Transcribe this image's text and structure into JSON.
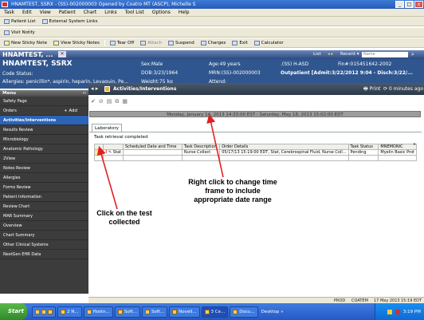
{
  "window": {
    "title": "HNAMTEST, SSRX - (SS)-002000003 Opened by Coatro MT (ASCP), Michelle S"
  },
  "menu": [
    "Task",
    "Edit",
    "View",
    "Patient",
    "Chart",
    "Links",
    "Tool List",
    "Options",
    "Help"
  ],
  "toolbar1": [
    {
      "label": "Patient List"
    },
    {
      "label": "External System Links"
    }
  ],
  "toolbar2": [
    {
      "label": "Visit Notify"
    }
  ],
  "toolbar3": [
    {
      "label": "New Sticky Note"
    },
    {
      "label": "View Sticky Notes"
    },
    {
      "label": "Tear Off"
    },
    {
      "label": "Attach"
    },
    {
      "label": "Suspend"
    },
    {
      "label": "Charges"
    },
    {
      "label": "Exit"
    },
    {
      "label": "Calculator"
    }
  ],
  "nav": {
    "short_name": "HNAMTEST, ...",
    "list": "List",
    "recent": "Recent",
    "name_placeholder": "Name"
  },
  "banner": {
    "name": "HNAMTEST, SSRX",
    "code_status": "Code Status:",
    "allergies": "Allergies: penicillin*, aspirin, heparin, Levaquin, Pe...",
    "sex": "Sex:Male",
    "dob": "DOB:3/23/1964",
    "weight": "Weight:75 kg",
    "age": "Age:49 years",
    "mrn": "MRN:(SS)-002000003",
    "attend": "Attend:",
    "loc": ".(SS) H-ASD",
    "fin": "Fin#:015451642-2002",
    "encounter": "Outpatient [Admit:3/22/2012 9:04 - Disch:3/22/..."
  },
  "sidebar": {
    "header": "Menu",
    "add_label": "Add",
    "items": [
      "Safety Page",
      "Orders",
      "Activities/Interventions",
      "Results Review",
      "Microbiology",
      "Anatomic Pathology",
      "2View",
      "Notes Review",
      "Allergies",
      "Forms Review",
      "Patient Information",
      "Review Chart",
      "MAR Summary",
      "Overview",
      "Chart Summary",
      "Other Clinical Systems",
      "NextGen EHR Data"
    ]
  },
  "main": {
    "title": "Activities/Interventions",
    "print": "Print",
    "refresh": "0 minutes ago",
    "date_range": "Monday, January 14, 2013 14:33:00 EST - Saturday, May 18, 2013 15:02:00 EDT",
    "tab": "Laboratory",
    "retrieval": "Task retrieval completed",
    "columns": [
      "",
      "",
      "Scheduled Date and Time",
      "Task Description",
      "Order Details",
      "Task Status",
      "MNEMONIC"
    ],
    "row": [
      "Stat",
      "",
      "Nurse Collect",
      "05/17/13 15:19:00 EDT, Stat, Cerebrospinal Fluid, Nurse Coll...",
      "Pending",
      "Myelin Basic Prot"
    ]
  },
  "annotations": {
    "right_click": "Right click to change time frame to include appropriate date range",
    "click_test": "Click on the test collected"
  },
  "status": {
    "prod": "PROD",
    "user": "COATEM",
    "date": "17 May 2013",
    "time": "15:19 EDT"
  },
  "taskbar": {
    "start": "Start",
    "tasks": [
      "2 N...",
      "Hostn...",
      "Soft...",
      "Soft...",
      "Novell...",
      "3 Ce...",
      "Docu..."
    ],
    "desktop": "Desktop",
    "clock": "3:19 PM"
  },
  "colors": {
    "banner": "#2f568f",
    "active": "#2b63b8",
    "arrow": "#e02020",
    "sidebar": "#3c3c3c"
  }
}
